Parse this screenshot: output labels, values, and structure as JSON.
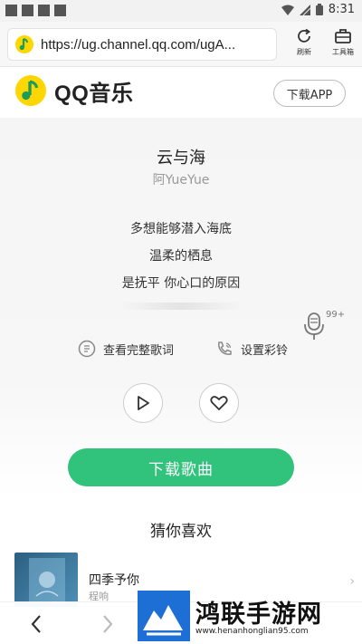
{
  "status_bar": {
    "time": "8:31",
    "icons": [
      "wifi-icon",
      "signal-icon",
      "battery-icon"
    ]
  },
  "browser": {
    "url": "https://ug.channel.qq.com/ugA...",
    "refresh_label": "刷新",
    "toolbox_label": "工具箱"
  },
  "app_header": {
    "brand": "QQ音乐",
    "download_app_label": "下载APP"
  },
  "song": {
    "title": "云与海",
    "artist": "阿YueYue",
    "lyrics": [
      "多想能够潜入海底",
      "温柔的栖息",
      "是抚平 你心口的原因"
    ],
    "mic_badge": "99+",
    "full_lyrics_label": "查看完整歌词",
    "ringtone_label": "设置彩铃",
    "download_song_label": "下载歌曲"
  },
  "recommend": {
    "section_title": "猜你喜欢",
    "items": [
      {
        "title": "四季予你",
        "artist": "程响"
      }
    ]
  },
  "watermark": {
    "title": "鸿联手游网",
    "url": "www.henanhonglian95.com"
  },
  "colors": {
    "accent_green": "#31c27c",
    "brand_yellow": "#ffd600",
    "watermark_blue": "#1d6fd6"
  }
}
